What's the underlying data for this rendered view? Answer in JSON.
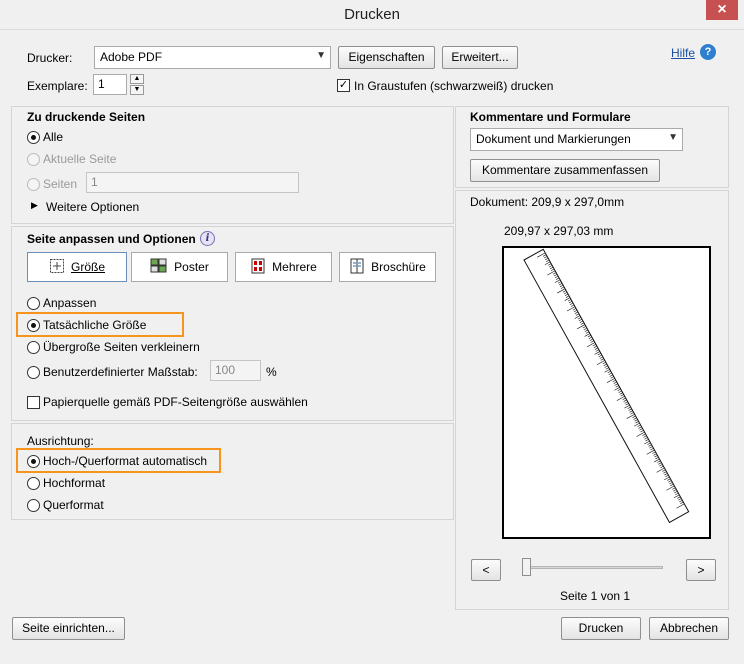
{
  "window": {
    "title": "Drucken",
    "close_glyph": "×"
  },
  "printer": {
    "label": "Drucker:",
    "value": "Adobe PDF",
    "properties_label": "Eigenschaften",
    "advanced_label": "Erweitert...",
    "help_label": "Hilfe"
  },
  "copies": {
    "label": "Exemplare:",
    "value": "1"
  },
  "grayscale": {
    "label": "In Graustufen (schwarzweiß) drucken",
    "checked": true
  },
  "pages": {
    "heading": "Zu druckende Seiten",
    "all": "Alle",
    "current": "Aktuelle Seite",
    "pages": "Seiten",
    "pages_value": "1",
    "more_options": "Weitere Optionen"
  },
  "sizing": {
    "heading": "Seite anpassen und Optionen",
    "buttons": {
      "size": "Größe",
      "poster": "Poster",
      "multiple": "Mehrere",
      "booklet": "Broschüre"
    },
    "fit": "Anpassen",
    "actual_size": "Tatsächliche Größe",
    "shrink": "Übergroße Seiten verkleinern",
    "custom_scale": "Benutzerdefinierter Maßstab:",
    "scale_value": "100",
    "percent": "%",
    "paper_source": "Papierquelle gemäß PDF-Seitengröße auswählen"
  },
  "orientation": {
    "heading": "Ausrichtung:",
    "auto": "Hoch-/Querformat automatisch",
    "portrait": "Hochformat",
    "landscape": "Querformat"
  },
  "comments": {
    "heading": "Kommentare und Formulare",
    "value": "Dokument und Markierungen",
    "summarize": "Kommentare zusammenfassen"
  },
  "preview": {
    "document_size": "Dokument: 209,9 x 297,0mm",
    "page_size": "209,97 x 297,03 mm",
    "prev": "<",
    "next": ">",
    "page_info": "Seite 1 von 1",
    "slider_fraction": 0
  },
  "footer": {
    "page_setup": "Seite einrichten...",
    "print": "Drucken",
    "cancel": "Abbrechen"
  },
  "colors": {
    "highlight": "#f7941d",
    "link": "#1a4fa3",
    "close": "#c75050"
  }
}
